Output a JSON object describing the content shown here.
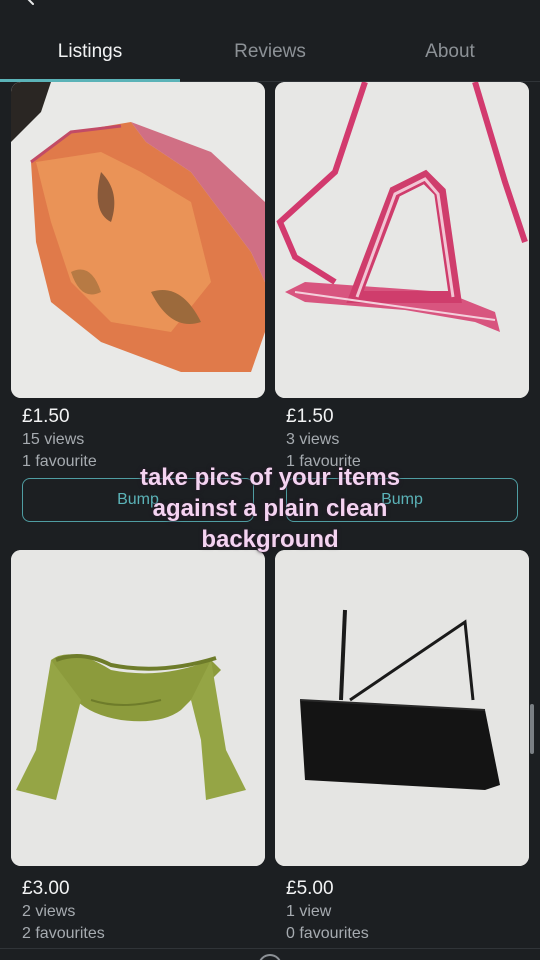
{
  "tabs": [
    {
      "label": "Listings",
      "active": true
    },
    {
      "label": "Reviews",
      "active": false
    },
    {
      "label": "About",
      "active": false
    }
  ],
  "listings": [
    {
      "price": "£1.50",
      "views": "15 views",
      "favourites": "1 favourite",
      "bump_label": "Bump",
      "item": "orange floral sheer top"
    },
    {
      "price": "£1.50",
      "views": "3 views",
      "favourites": "1 favourite",
      "bump_label": "Bump",
      "item": "pink striped halter bikini top"
    },
    {
      "price": "£3.00",
      "views": "2 views",
      "favourites": "2 favourites",
      "item": "green off-shoulder crop top"
    },
    {
      "price": "£5.00",
      "views": "1 view",
      "favourites": "0 favourites",
      "item": "black asymmetric bandeau top"
    }
  ],
  "overlay_caption": [
    "take pics of your items",
    "against a plain clean",
    "background"
  ],
  "colors": {
    "accent": "#5bb3b8",
    "caption": "#f4d3f1",
    "background": "#1c1f22"
  }
}
